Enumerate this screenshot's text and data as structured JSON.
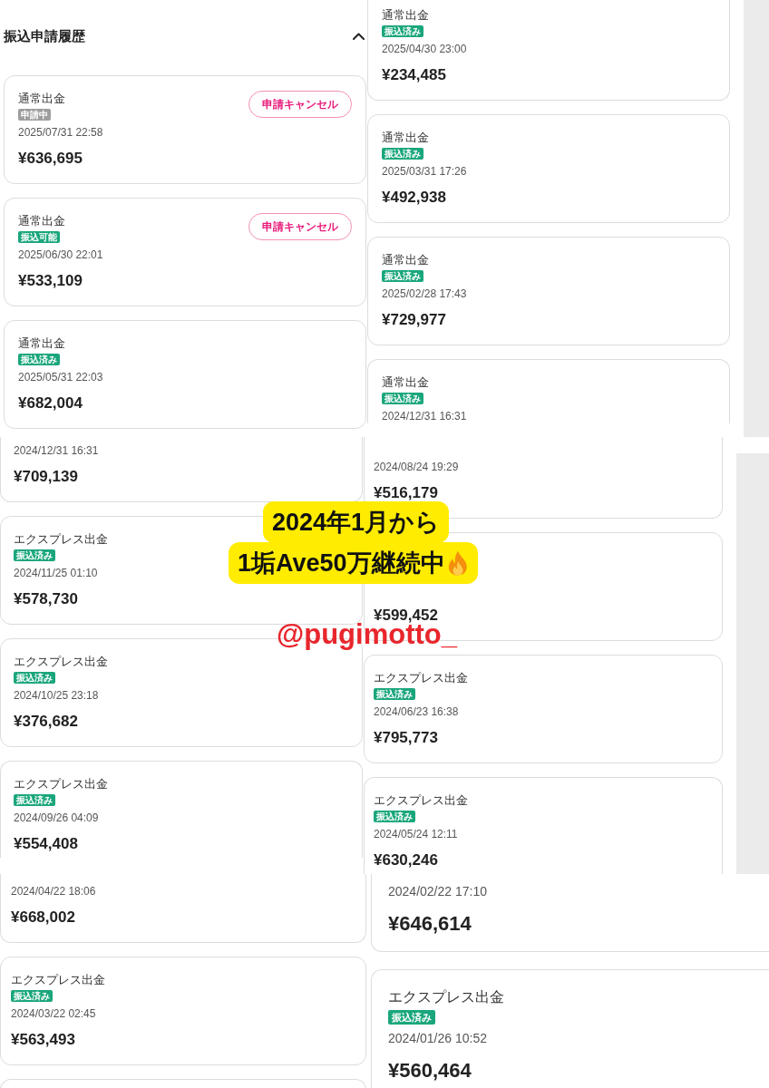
{
  "rows": [
    {
      "panels": [
        {
          "header": {
            "title": "振込申請履歴",
            "expanded": true
          },
          "cards": [
            {
              "kind": "whole",
              "label": "通常出金",
              "status": {
                "text": "申請中",
                "color": "#9e9e9e"
              },
              "date": "2025/07/31 22:58",
              "amount": "¥636,695",
              "cancel_button": "申請キャンセル"
            },
            {
              "kind": "whole",
              "label": "通常出金",
              "status": {
                "text": "振込可能",
                "color": "#1aa67c"
              },
              "date": "2025/06/30 22:01",
              "amount": "¥533,109",
              "cancel_button": "申請キャンセル"
            },
            {
              "kind": "whole",
              "label": "通常出金",
              "status": {
                "text": "振込済み",
                "color": "#1aa67c"
              },
              "date": "2025/05/31 22:03",
              "amount": "¥682,004"
            }
          ]
        },
        {
          "cards": [
            {
              "kind": "tail",
              "label": "通常出金",
              "status": {
                "text": "振込済み",
                "color": "#1aa67c"
              },
              "date": "2025/04/30 23:00",
              "amount": "¥234,485"
            },
            {
              "kind": "whole",
              "label": "通常出金",
              "status": {
                "text": "振込済み",
                "color": "#1aa67c"
              },
              "date": "2025/03/31 17:26",
              "amount": "¥492,938"
            },
            {
              "kind": "whole",
              "label": "通常出金",
              "status": {
                "text": "振込済み",
                "color": "#1aa67c"
              },
              "date": "2025/02/28 17:43",
              "amount": "¥729,977"
            },
            {
              "kind": "head",
              "label": "通常出金",
              "status": {
                "text": "振込済み",
                "color": "#1aa67c"
              },
              "date": "2024/12/31 16:31"
            }
          ]
        }
      ]
    },
    {
      "panels": [
        {
          "cards": [
            {
              "kind": "tail",
              "date": "2024/12/31 16:31",
              "amount": "¥709,139"
            },
            {
              "kind": "whole",
              "label": "エクスプレス出金",
              "status": {
                "text": "振込済み",
                "color": "#1aa67c"
              },
              "date": "2024/11/25 01:10",
              "amount": "¥578,730"
            },
            {
              "kind": "whole",
              "label": "エクスプレス出金",
              "status": {
                "text": "振込済み",
                "color": "#1aa67c"
              },
              "date": "2024/10/25 23:18",
              "amount": "¥376,682"
            },
            {
              "kind": "head",
              "label": "エクスプレス出金",
              "status": {
                "text": "振込済み",
                "color": "#1aa67c"
              },
              "date": "2024/09/26 04:09",
              "amount": "¥554,408"
            }
          ]
        },
        {
          "cards": [
            {
              "kind": "tail",
              "date": "2024/08/24 19:29",
              "amount": "¥516,179"
            },
            {
              "kind": "whole",
              "amount": "¥599,452"
            },
            {
              "kind": "whole",
              "label": "エクスプレス出金",
              "status": {
                "text": "振込済み",
                "color": "#1aa67c"
              },
              "date": "2024/06/23 16:38",
              "amount": "¥795,773"
            },
            {
              "kind": "head",
              "label": "エクスプレス出金",
              "status": {
                "text": "振込済み",
                "color": "#1aa67c"
              },
              "date": "2024/05/24 12:11",
              "amount": "¥630,246"
            }
          ]
        }
      ]
    },
    {
      "panels": [
        {
          "cards": [
            {
              "kind": "tail",
              "date": "2024/04/22 18:06",
              "amount": "¥668,002"
            },
            {
              "kind": "whole",
              "label": "エクスプレス出金",
              "status": {
                "text": "振込済み",
                "color": "#1aa67c"
              },
              "date": "2024/03/22 02:45",
              "amount": "¥563,493"
            },
            {
              "kind": "head"
            }
          ]
        },
        {
          "cards": [
            {
              "kind": "tail",
              "date": "2024/02/22 17:10",
              "amount": "¥646,614"
            },
            {
              "kind": "whole",
              "label": "エクスプレス出金",
              "status": {
                "text": "振込済み",
                "color": "#1aa67c"
              },
              "date": "2024/01/26 10:52",
              "amount": "¥560,464"
            }
          ]
        }
      ]
    }
  ],
  "caption": {
    "lines": [
      "2024年1月から",
      "1垢Ave50万継続中"
    ]
  },
  "handle": "@pugimotto_"
}
